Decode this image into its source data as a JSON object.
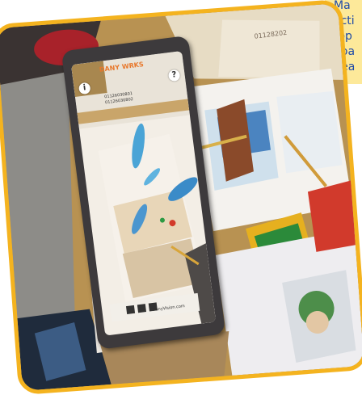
{
  "caption": {
    "lines": [
      "Ma",
      "acti",
      "top",
      "boa",
      "Rea"
    ],
    "background": "#fde99a",
    "text_color": "#1e4aa8"
  },
  "photo": {
    "frame_color": "#f4b31f",
    "description_icons": [
      "tablet",
      "coloring-sheets",
      "crayon-box",
      "pencils"
    ]
  },
  "tablet_screen": {
    "top_logo": "DANY WRKS",
    "phone_numbers": [
      "01126030801",
      "01126030802"
    ],
    "bottom_site": "DanyVision.com",
    "left_icon": "info-icon",
    "right_icon": "question-icon"
  },
  "background_sheet": {
    "phone_fragment": "01128202"
  }
}
